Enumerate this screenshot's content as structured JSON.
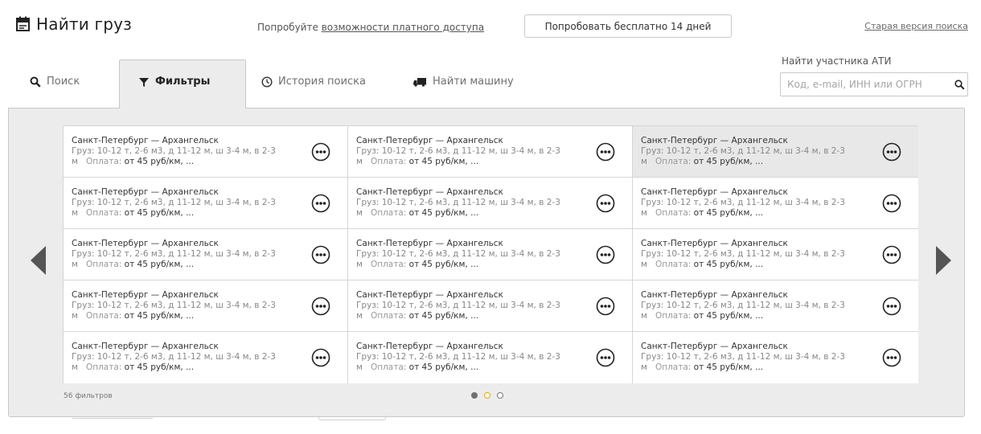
{
  "header": {
    "title": "Найти груз",
    "promo_text": "Попробуйте ",
    "promo_link": "возможности платного доступа",
    "trial_button": "Попробовать бесплатно 14 дней",
    "old_version_link": "Старая версия поиска"
  },
  "ati_search": {
    "label": "Найти участника АТИ",
    "placeholder": "Код, e-mail, ИНН или ОГРН"
  },
  "tabs": [
    {
      "label": "Поиск",
      "icon": "search-icon",
      "active": false
    },
    {
      "label": "Фильтры",
      "icon": "filter-icon",
      "active": true
    },
    {
      "label": "История поиска",
      "icon": "clock-icon",
      "active": false
    },
    {
      "label": "Найти машину",
      "icon": "truck-icon",
      "active": false
    }
  ],
  "filters": [
    {
      "route": "Санкт-Петербург — Архангельск",
      "cargo_label": "Груз:",
      "cargo": "10-12 т, 2-6 м3, д 11-12 м, ш 3-4 м, в 2-3 м",
      "payment_label": "Оплата:",
      "payment": "от 45 руб/км, ..."
    },
    {
      "route": "Санкт-Петербург — Архангельск",
      "cargo_label": "Груз:",
      "cargo": "10-12 т, 2-6 м3, д 11-12 м, ш 3-4 м, в 2-3 м",
      "payment_label": "Оплата:",
      "payment": "от 45 руб/км, ..."
    },
    {
      "route": "Санкт-Петербург — Архангельск",
      "cargo_label": "Груз:",
      "cargo": "10-12 т, 2-6 м3, д 11-12 м, ш 3-4 м, в 2-3 м",
      "payment_label": "Оплата:",
      "payment": "от 45 руб/км, ..."
    },
    {
      "route": "Санкт-Петербург — Архангельск",
      "cargo_label": "Груз:",
      "cargo": "10-12 т, 2-6 м3, д 11-12 м, ш 3-4 м, в 2-3 м",
      "payment_label": "Оплата:",
      "payment": "от 45 руб/км, ..."
    },
    {
      "route": "Санкт-Петербург — Архангельск",
      "cargo_label": "Груз:",
      "cargo": "10-12 т, 2-6 м3, д 11-12 м, ш 3-4 м, в 2-3 м",
      "payment_label": "Оплата:",
      "payment": "от 45 руб/км, ..."
    },
    {
      "route": "Санкт-Петербург — Архангельск",
      "cargo_label": "Груз:",
      "cargo": "10-12 т, 2-6 м3, д 11-12 м, ш 3-4 м, в 2-3 м",
      "payment_label": "Оплата:",
      "payment": "от 45 руб/км, ..."
    },
    {
      "route": "Санкт-Петербург — Архангельск",
      "cargo_label": "Груз:",
      "cargo": "10-12 т, 2-6 м3, д 11-12 м, ш 3-4 м, в 2-3 м",
      "payment_label": "Оплата:",
      "payment": "от 45 руб/км, ..."
    },
    {
      "route": "Санкт-Петербург — Архангельск",
      "cargo_label": "Груз:",
      "cargo": "10-12 т, 2-6 м3, д 11-12 м, ш 3-4 м, в 2-3 м",
      "payment_label": "Оплата:",
      "payment": "от 45 руб/км, ..."
    },
    {
      "route": "Санкт-Петербург — Архангельск",
      "cargo_label": "Груз:",
      "cargo": "10-12 т, 2-6 м3, д 11-12 м, ш 3-4 м, в 2-3 м",
      "payment_label": "Оплата:",
      "payment": "от 45 руб/км, ..."
    },
    {
      "route": "Санкт-Петербург — Архангельск",
      "cargo_label": "Груз:",
      "cargo": "10-12 т, 2-6 м3, д 11-12 м, ш 3-4 м, в 2-3 м",
      "payment_label": "Оплата:",
      "payment": "от 45 руб/км, ..."
    },
    {
      "route": "Санкт-Петербург — Архангельск",
      "cargo_label": "Груз:",
      "cargo": "10-12 т, 2-6 м3, д 11-12 м, ш 3-4 м, в 2-3 м",
      "payment_label": "Оплата:",
      "payment": "от 45 руб/км, ..."
    },
    {
      "route": "Санкт-Петербург — Архангельск",
      "cargo_label": "Груз:",
      "cargo": "10-12 т, 2-6 м3, д 11-12 м, ш 3-4 м, в 2-3 м",
      "payment_label": "Оплата:",
      "payment": "от 45 руб/км, ..."
    },
    {
      "route": "Санкт-Петербург — Архангельск",
      "cargo_label": "Груз:",
      "cargo": "10-12 т, 2-6 м3, д 11-12 м, ш 3-4 м, в 2-3 м",
      "payment_label": "Оплата:",
      "payment": "от 45 руб/км, ..."
    },
    {
      "route": "Санкт-Петербург — Архангельск",
      "cargo_label": "Груз:",
      "cargo": "10-12 т, 2-6 м3, д 11-12 м, ш 3-4 м, в 2-3 м",
      "payment_label": "Оплата:",
      "payment": "от 45 руб/км, ..."
    },
    {
      "route": "Санкт-Петербург — Архангельск",
      "cargo_label": "Груз:",
      "cargo": "10-12 т, 2-6 м3, д 11-12 м, ш 3-4 м, в 2-3 м",
      "payment_label": "Оплата:",
      "payment": "от 45 руб/км, ..."
    }
  ],
  "highlighted_index": 2,
  "footer": {
    "count_text": "56 фильтров",
    "active_page": 2
  },
  "colors": {
    "panel_bg": "#ececec",
    "border": "#c8c8c8",
    "accent_dot": "#f0a000"
  }
}
